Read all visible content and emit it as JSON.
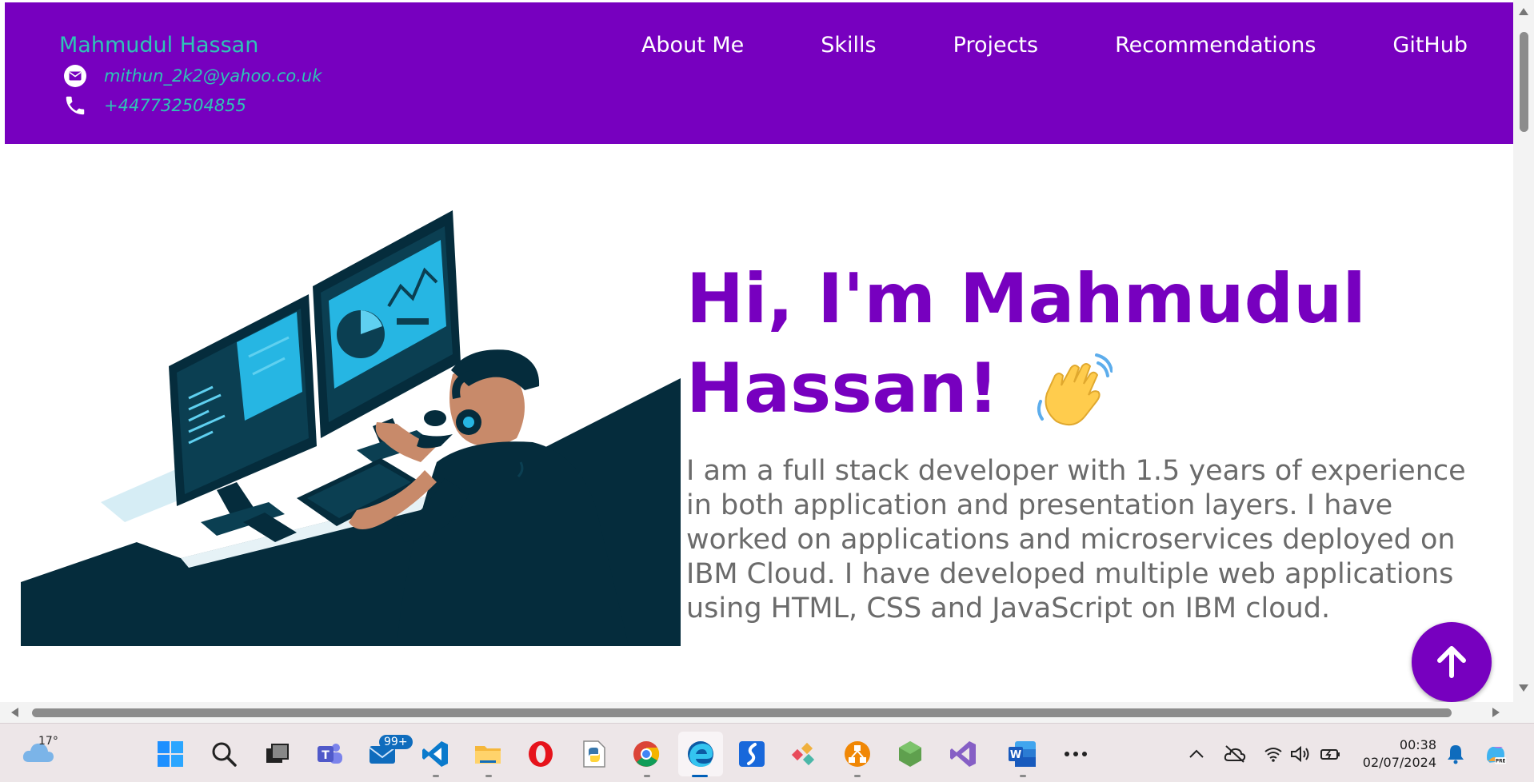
{
  "header": {
    "name": "Mahmudul Hassan",
    "email": "mithun_2k2@yahoo.co.uk",
    "phone": "+447732504855",
    "nav": [
      "About Me",
      "Skills",
      "Projects",
      "Recommendations",
      "GitHub"
    ]
  },
  "hero": {
    "title_line1": "Hi, I'm Mahmudul",
    "title_line2": "Hassan!",
    "description": "I am a full stack developer with 1.5 years of experience in both application and presentation layers. I have worked on applications and microservices deployed on IBM Cloud. I have developed multiple web applications using HTML, CSS and JavaScript on IBM cloud.",
    "wave_icon": "waving-hand-icon"
  },
  "colors": {
    "brand_purple": "#7700bf",
    "teal": "#2ec4b6",
    "text_gray": "#6b6b6b"
  },
  "taskbar": {
    "weather_temp": "17°",
    "mail_badge": "99+",
    "time": "00:38",
    "date": "02/07/2024",
    "apps": [
      "start-icon",
      "search-icon",
      "task-view-icon",
      "teams-icon",
      "mail-icon",
      "vscode-icon",
      "file-explorer-icon",
      "opera-icon",
      "python-file-icon",
      "chrome-icon",
      "edge-icon",
      "sourcetree-icon",
      "git-kraken-icon",
      "draw-io-icon",
      "nodejs-icon",
      "visual-studio-icon",
      "word-icon",
      "more-icon"
    ]
  }
}
